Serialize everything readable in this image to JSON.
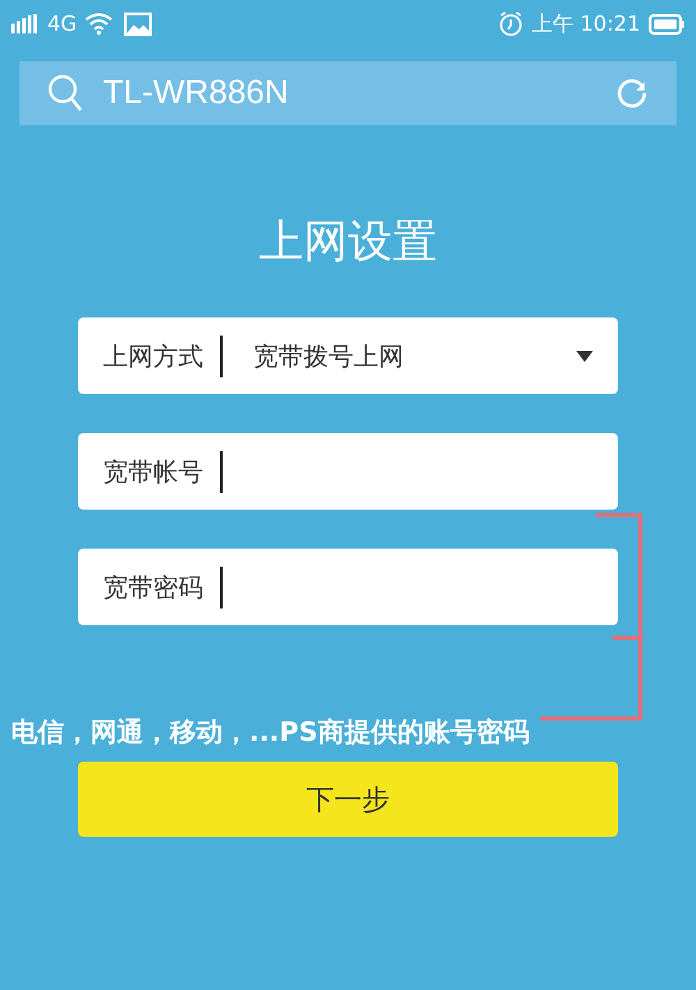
{
  "status_bar": {
    "network": "4G",
    "time": "上午 10:21"
  },
  "search": {
    "value": "TL-WR886N"
  },
  "title": "上网设置",
  "fields": [
    {
      "kind": "select",
      "label": "上网方式",
      "value": "宽带拨号上网"
    },
    {
      "kind": "input",
      "label": "宽带帐号"
    },
    {
      "kind": "input",
      "label": "宽带密码"
    }
  ],
  "annotation": "电信，网通，移动，...PS商提供的账号密码",
  "button": "下一步"
}
